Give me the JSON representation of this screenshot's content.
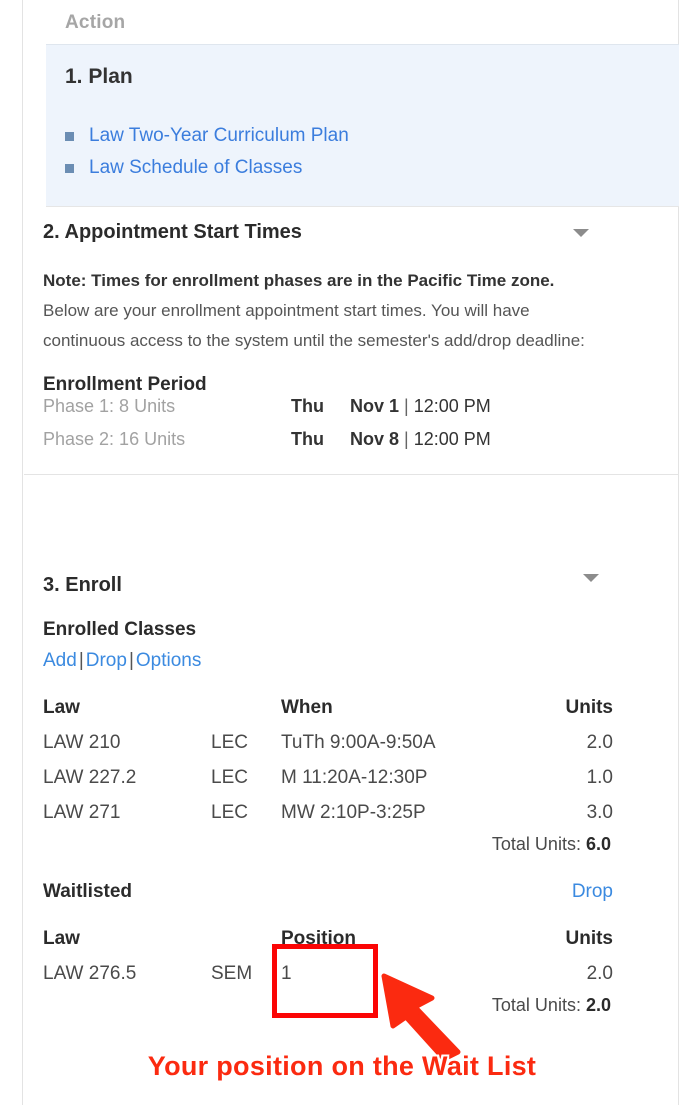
{
  "header": {
    "label": "Action"
  },
  "colors": {
    "link": "#3b7ddd",
    "annotation_red": "#fb2a10",
    "plan_panel_bg": "#eef4fc",
    "muted_text": "#a2a2a2"
  },
  "section_plan": {
    "title": "1. Plan",
    "links": [
      {
        "label": "Law Two-Year Curriculum Plan"
      },
      {
        "label": "Law Schedule of Classes"
      }
    ]
  },
  "section_appointments": {
    "title": "2. Appointment Start Times",
    "note_bold": "Note: Times for enrollment phases are in the Pacific Time zone.",
    "note_body": "Below are your enrollment appointment start times. You will have continuous access to the system until the semester's add/drop deadline:",
    "enrollment_period_title": "Enrollment Period",
    "phases": [
      {
        "label": "Phase 1: 8 Units",
        "day": "Thu",
        "date": "Nov 1",
        "separator": "|",
        "time": "12:00 PM"
      },
      {
        "label": "Phase 2: 16 Units",
        "day": "Thu",
        "date": "Nov 8",
        "separator": "|",
        "time": "12:00 PM"
      }
    ]
  },
  "section_enroll": {
    "title": "3. Enroll",
    "enrolled_heading": "Enrolled Classes",
    "actions": [
      {
        "label": "Add"
      },
      {
        "label": "Drop"
      },
      {
        "label": "Options"
      }
    ],
    "action_separator": "|",
    "enrolled_table": {
      "headers": {
        "course": "Law",
        "type": "",
        "when": "When",
        "units": "Units"
      },
      "rows": [
        {
          "course": "LAW 210",
          "type": "LEC",
          "when": "TuTh 9:00A-9:50A",
          "units": "2.0"
        },
        {
          "course": "LAW 227.2",
          "type": "LEC",
          "when": "M 11:20A-12:30P",
          "units": "1.0"
        },
        {
          "course": "LAW 271",
          "type": "LEC",
          "when": "MW 2:10P-3:25P",
          "units": "3.0"
        }
      ],
      "total_label": "Total Units:",
      "total_value": "6.0"
    },
    "waitlisted": {
      "label": "Waitlisted",
      "drop_label": "Drop",
      "headers": {
        "course": "Law",
        "type": "",
        "position": "Position",
        "units": "Units"
      },
      "rows": [
        {
          "course": "LAW 276.5",
          "type": "SEM",
          "position": "1",
          "units": "2.0"
        }
      ],
      "total_label": "Total Units:",
      "total_value": "2.0"
    }
  },
  "annotation": {
    "caption": "Your position on the Wait List"
  }
}
